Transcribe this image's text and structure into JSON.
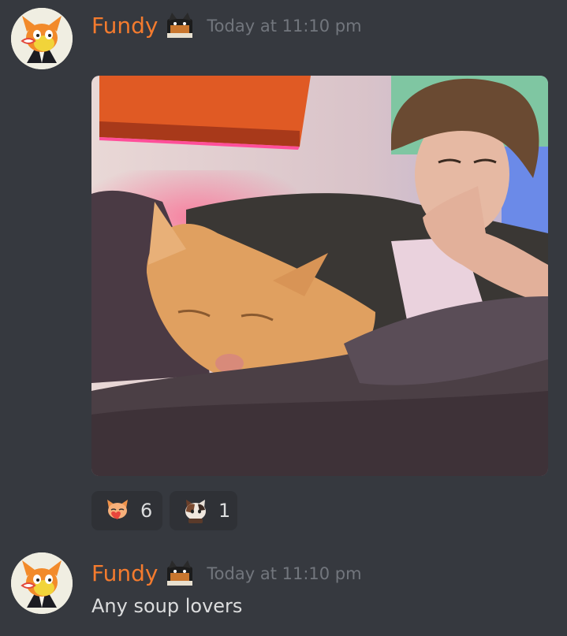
{
  "messages": [
    {
      "username": "Fundy",
      "timestamp": "Today at 11:10 pm",
      "attachment": {
        "type": "image",
        "subject": "selfie with sleeping orange cat"
      },
      "reactions": [
        {
          "emoji": "cat-heart-emoji",
          "count": "6"
        },
        {
          "emoji": "calico-cat-emoji",
          "count": "1"
        }
      ]
    },
    {
      "username": "Fundy",
      "timestamp": "Today at 11:10 pm",
      "content": "Any soup lovers"
    }
  ],
  "colors": {
    "background": "#36393f",
    "username": "#f47b2e",
    "timestamp": "#72767d",
    "text": "#dcddde",
    "reaction_bg": "#2f3136"
  }
}
